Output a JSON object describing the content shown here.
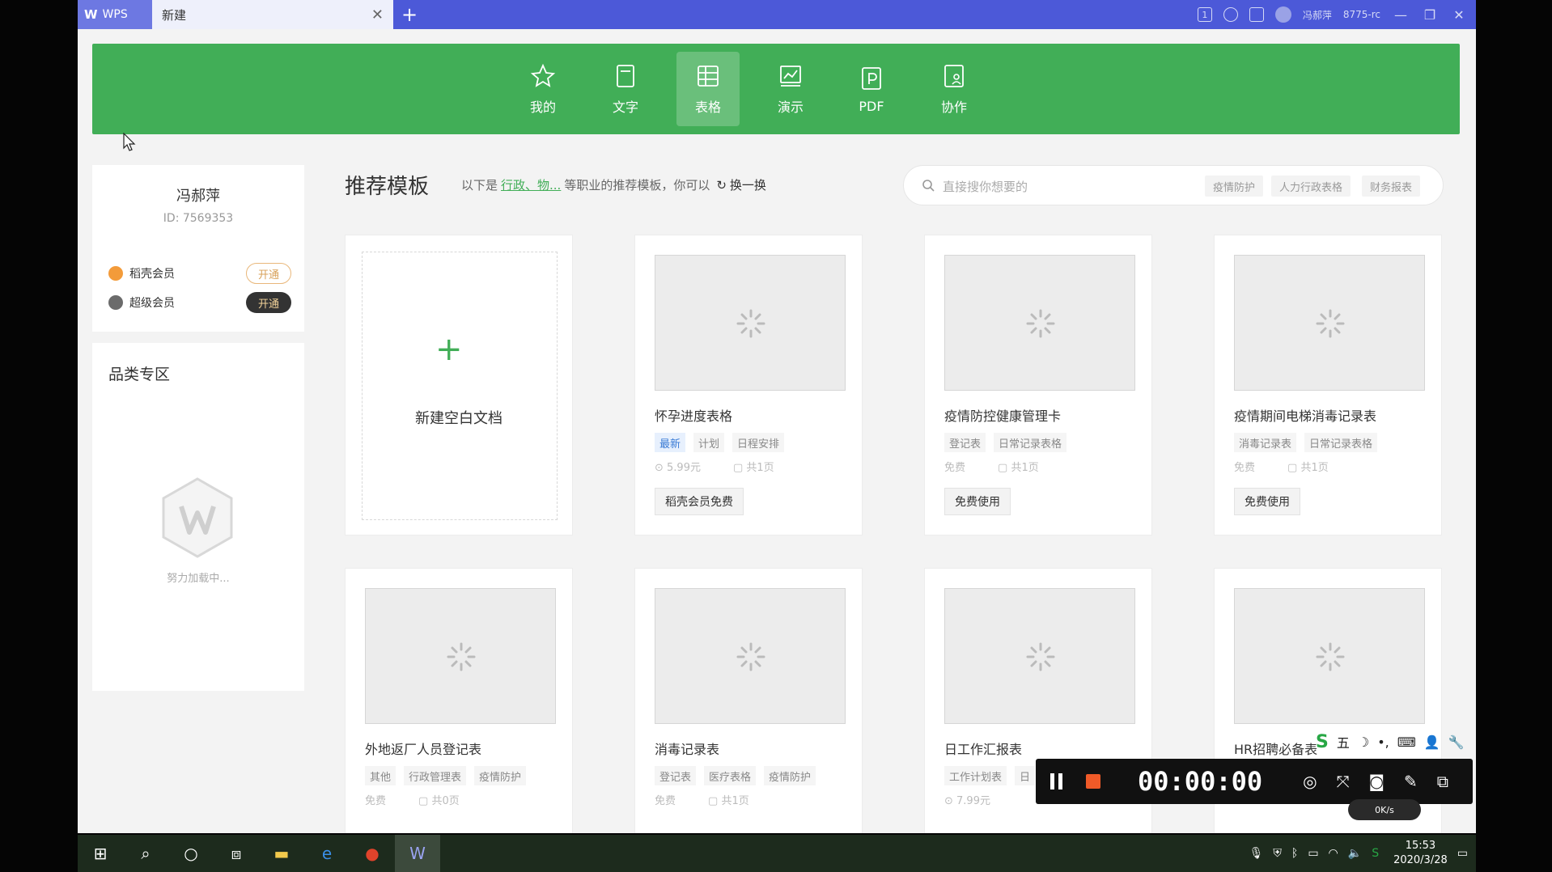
{
  "titlebar": {
    "brand": "WPS",
    "tab_label": "新建",
    "close": "✕",
    "plus": "+",
    "user": "冯郝萍",
    "user_extra": "8775-rc",
    "win_min": "—",
    "win_max": "❐",
    "win_close": "✕"
  },
  "nav": {
    "items": [
      {
        "label": "我的"
      },
      {
        "label": "文字"
      },
      {
        "label": "表格"
      },
      {
        "label": "演示"
      },
      {
        "label": "PDF"
      },
      {
        "label": "协作"
      }
    ],
    "active": "表格"
  },
  "user": {
    "name": "冯郝萍",
    "id": "ID: 7569353",
    "members": [
      {
        "label": "稻壳会员",
        "btn": "开通"
      },
      {
        "label": "超级会员",
        "btn": "开通"
      }
    ]
  },
  "category": {
    "title": "品类专区",
    "loading": "努力加载中..."
  },
  "header": {
    "title": "推荐模板",
    "desc_prefix": "以下是",
    "desc_link": "行政、物...",
    "desc_suffix": "等职业的推荐模板，你可以",
    "swap": "换一换"
  },
  "search": {
    "placeholder": "直接搜你想要的",
    "chips": [
      "疫情防护",
      "人力行政表格",
      "财务报表"
    ]
  },
  "blank": {
    "plus": "+",
    "label": "新建空白文档"
  },
  "cards": [
    {
      "title": "怀孕进度表格",
      "tags": [
        "最新",
        "计划",
        "日程安排"
      ],
      "price": "5.99元",
      "pages": "共1页",
      "button": "稻壳会员免费"
    },
    {
      "title": "疫情防控健康管理卡",
      "tags": [
        "登记表",
        "日常记录表格"
      ],
      "price": "免费",
      "pages": "共1页",
      "button": "免费使用"
    },
    {
      "title": "疫情期间电梯消毒记录表",
      "tags": [
        "消毒记录表",
        "日常记录表格"
      ],
      "price": "免费",
      "pages": "共1页",
      "button": "免费使用"
    },
    {
      "title": "外地返厂人员登记表",
      "tags": [
        "其他",
        "行政管理表",
        "疫情防护"
      ],
      "price": "免费",
      "pages": "共0页"
    },
    {
      "title": "消毒记录表",
      "tags": [
        "登记表",
        "医疗表格",
        "疫情防护"
      ],
      "price": "免费",
      "pages": "共1页"
    },
    {
      "title": "日工作汇报表",
      "tags": [
        "工作计划表",
        "日"
      ],
      "price": "7.99元",
      "pages": ""
    },
    {
      "title": "HR招聘必备表",
      "tags": [],
      "price": "",
      "pages": ""
    }
  ],
  "recorder": {
    "time": "00:00:00",
    "speed": "0K/s",
    "ime": [
      "S",
      "五",
      "☽",
      "•,",
      "⌨",
      "👤",
      "🔧"
    ]
  },
  "taskbar": {
    "time": "15:53",
    "date": "2020/3/28"
  }
}
